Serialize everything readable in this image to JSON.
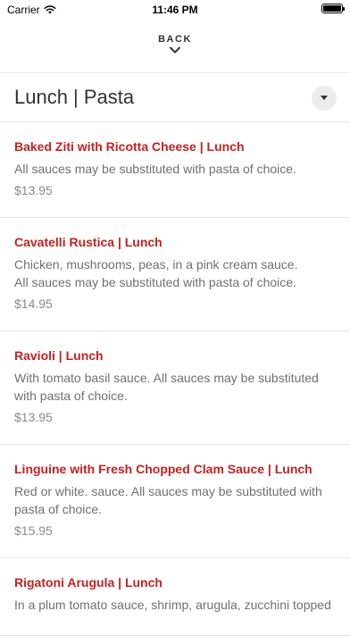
{
  "status_bar": {
    "carrier": "Carrier",
    "time": "11:46 PM"
  },
  "nav": {
    "back_label": "BACK"
  },
  "header": {
    "title": "Lunch | Pasta"
  },
  "menu_items": [
    {
      "name": "Baked Ziti with Ricotta Cheese | Lunch",
      "description": "All sauces may be substituted with pasta of choice.",
      "price": "$13.95"
    },
    {
      "name": "Cavatelli Rustica | Lunch",
      "description": "Chicken, mushrooms, peas, in a pink cream sauce.\nAll sauces may be substituted with pasta of choice.",
      "price": "$14.95"
    },
    {
      "name": "Ravioli | Lunch",
      "description": "With tomato basil sauce. All sauces may be substituted with pasta of choice.",
      "price": "$13.95"
    },
    {
      "name": "Linguine with Fresh Chopped Clam Sauce | Lunch",
      "description": "Red or white. sauce. All sauces may be substituted with pasta of choice.",
      "price": "$15.95"
    },
    {
      "name": "Rigatoni Arugula | Lunch",
      "description": "In a plum tomato sauce, shrimp, arugula, zucchini topped",
      "price": ""
    }
  ],
  "colors": {
    "accent": "#c8201e",
    "text_primary": "#333333",
    "text_secondary": "#707070",
    "divider": "#e6e6e6"
  },
  "icons": {
    "wifi": "wifi-icon",
    "battery": "battery-icon",
    "back_chevron": "chevron-down-icon",
    "dropdown": "caret-down-icon"
  }
}
